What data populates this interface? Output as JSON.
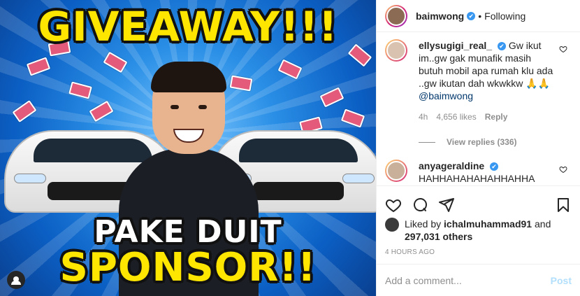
{
  "post_image": {
    "headline_top": "GIVEAWAY!!!",
    "headline_mid": "PAKE DUIT",
    "headline_bottom": "SPONSOR!!",
    "colors": {
      "background": "#1f7fe0",
      "headline": "#ffe600"
    },
    "tag_icon": "user-tag-icon"
  },
  "header": {
    "username": "baimwong",
    "verified": "✔",
    "separator": "•",
    "follow_status": "Following"
  },
  "comments": [
    {
      "username": "ellysugigi_real_",
      "verified": "✔",
      "text": "Gw ikut im..gw gak munafik masih butuh mobil apa rumah klu ada ..gw ikutan dah wkwkkw 🙏🙏 ",
      "mention": "@baimwong",
      "time": "4h",
      "likes": "4,656 likes",
      "reply": "Reply",
      "view_replies": "View replies (336)"
    },
    {
      "username": "anyageraldine",
      "verified": "✔",
      "text": "HAHHAHAHAHAHHAHHA"
    }
  ],
  "actions": {
    "like_icon": "heart-icon",
    "comment_icon": "comment-icon",
    "share_icon": "share-icon",
    "save_icon": "bookmark-icon"
  },
  "likes": {
    "prefix": "Liked by ",
    "user": "ichalmuhammad91",
    "and": " and",
    "others": "297,031 others"
  },
  "timestamp": "4 HOURS AGO",
  "add_comment": {
    "placeholder": "Add a comment...",
    "post_label": "Post"
  }
}
